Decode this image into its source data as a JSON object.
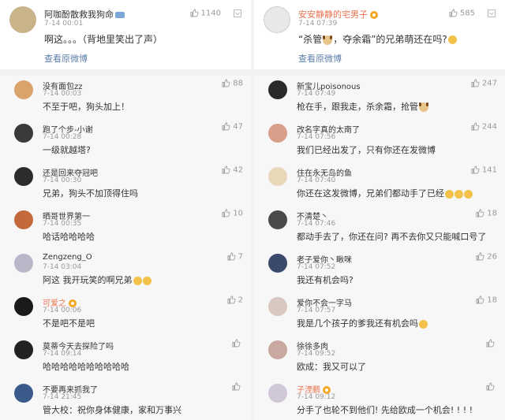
{
  "left": {
    "top": {
      "name": "阿咖酚散救我狗命",
      "time": "7-14 00:01",
      "text": "啊这。。。（背地里笑出了声）",
      "likes": "1140",
      "link": "查看原微博",
      "avatar_color": "#c9b48a"
    },
    "items": [
      {
        "name": "没有面包zz",
        "time": "7-14 00:03",
        "text": "不至于吧，狗头加上！",
        "likes": "88",
        "avatar_color": "#d9a36a",
        "orange": false
      },
      {
        "name": "跑了个步-小谢",
        "time": "7-14 00:28",
        "text": "一级就越塔?",
        "likes": "47",
        "avatar_color": "#3a3a3a",
        "orange": false
      },
      {
        "name": "还是回来夺冠吧",
        "time": "7-14 00:30",
        "text": "兄弟，狗头不加顶得住吗",
        "likes": "42",
        "avatar_color": "#2c2c2c",
        "orange": false
      },
      {
        "name": "晒哥世界第一",
        "time": "7-14 00:35",
        "text": "哈话哈哈哈哈",
        "likes": "10",
        "avatar_color": "#c46a3a",
        "orange": false
      },
      {
        "name": "Zengzeng_O",
        "time": "7-14 03:04",
        "text": "阿这 我开玩笑的啊兄弟",
        "likes": "7",
        "avatar_color": "#b8b8c8",
        "orange": false,
        "emoji_count": 2
      },
      {
        "name": "可爱之",
        "time": "7-14 00:06",
        "text": "不是吧不是吧",
        "likes": "2",
        "avatar_color": "#1a1a1a",
        "orange": true
      },
      {
        "name": "莫蒂今天去探险了吗",
        "time": "7-14 09:14",
        "text": "哈哈哈哈哈哈哈哈哈哈",
        "likes": "",
        "avatar_color": "#222222",
        "orange": false
      },
      {
        "name": "不要再来抓我了",
        "time": "7-14 21:45",
        "text": "管大校：祝你身体健康，家和万事兴",
        "likes": "",
        "avatar_color": "#3a5a8a",
        "orange": false
      }
    ]
  },
  "right": {
    "top": {
      "name": "安安静静的宅男子",
      "time": "7-14 07:39",
      "text_before": "“杀管",
      "text_mid": "，夺余霜”的兄弟萌还在吗?",
      "likes": "585",
      "link": "查看原微博",
      "avatar_color": "#e8e8e8"
    },
    "items": [
      {
        "name": "新宝儿poisonous",
        "time": "7-14 07:49",
        "text": "枪在手，跟我走，杀余霜，抢管",
        "likes": "247",
        "avatar_color": "#2a2a2a",
        "orange": false,
        "trailing_dog": true
      },
      {
        "name": "改名字真的太南了",
        "time": "7-14 07:56",
        "text": "我们已经出发了，只有你还在发微博",
        "likes": "244",
        "avatar_color": "#d8a08a",
        "orange": false
      },
      {
        "name": "住在永无岛的鱼",
        "time": "7-14 07:40",
        "text": "你还在这发微博，兄弟们都动手了已经",
        "likes": "141",
        "avatar_color": "#e8d8b8",
        "orange": false,
        "emoji_count": 3
      },
      {
        "name": "不清楚丶",
        "time": "7-14 07:46",
        "text": "都动手去了，你还在问? 再不去你又只能喊口号了",
        "likes": "18",
        "avatar_color": "#4a4a4a",
        "orange": false
      },
      {
        "name": "老子爱你丶瞅咪",
        "time": "7-14 07:52",
        "text": "我还有机会吗?",
        "likes": "26",
        "avatar_color": "#3a4a6a",
        "orange": false
      },
      {
        "name": "爱你不会一字马",
        "time": "7-14 07:57",
        "text": "我是几个孩子的爹我还有机会吗",
        "likes": "18",
        "avatar_color": "#d8c8c0",
        "orange": false,
        "emoji_count": 1
      },
      {
        "name": "徐徐多肉",
        "time": "7-14 09:52",
        "text": "欧成：我又可以了",
        "likes": "",
        "avatar_color": "#c8a8a0",
        "orange": false
      },
      {
        "name": "子湮鹏",
        "time": "7-14 09:12",
        "text": "分手了也轮不到他们! 先给欧成一个机会! ! ! !",
        "likes": "",
        "avatar_color": "#d0c8d8",
        "orange": true
      }
    ]
  },
  "colors": {
    "name_orange": "#eb7350",
    "link_blue": "#5d7fab",
    "muted": "#999999"
  },
  "icons": [
    "thumbs-up-icon",
    "more-icon",
    "vip-badge-icon",
    "crown-badge-icon",
    "dog-head-emoji",
    "laugh-emoji"
  ]
}
